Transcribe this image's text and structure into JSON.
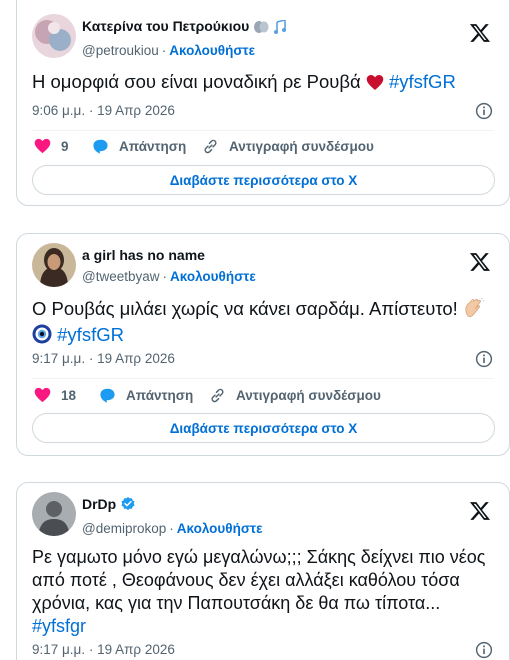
{
  "tweets": [
    {
      "author_name": "Κατερίνα του Πετρούκιου",
      "handle": "@petroukiou",
      "follow_label": "Ακολουθήστε",
      "text": "Η ομορφιά σου είναι μοναδική ρε Ρουβά",
      "hashtag": "#yfsfGR",
      "timestamp": "9:06 μ.μ. · 19 Απρ 2026",
      "likes": "9",
      "reply_label": "Απάντηση",
      "copy_link_label": "Αντιγραφή συνδέσμου",
      "read_more_label": "Διαβάστε περισσότερα στο X"
    },
    {
      "author_name": "a girl has no name",
      "handle": "@tweetbyaw",
      "follow_label": "Ακολουθήστε",
      "text": "Ο Ρουβάς μιλάει χωρίς να κάνει σαρδάμ. Απίστευτο!",
      "hashtag": "#yfsfGR",
      "timestamp": "9:17 μ.μ. · 19 Απρ 2026",
      "likes": "18",
      "reply_label": "Απάντηση",
      "copy_link_label": "Αντιγραφή συνδέσμου",
      "read_more_label": "Διαβάστε περισσότερα στο X"
    },
    {
      "author_name": "DrDp",
      "handle": "@demiprokop",
      "follow_label": "Ακολουθήστε",
      "text_line1": "Ρε γαμωτο μόνο εγώ μεγαλώνω;;; Σάκης δείχνει πιο νέος",
      "text_line2": "από ποτέ , Θεοφάνους δεν έχει αλλάξει καθόλου τόσα",
      "text_line3": "χρόνια, κας για την Παπουτσάκη δε θα πω τίποτα...",
      "hashtag": "#yfsfgr",
      "timestamp": "9:17 μ.μ. · 19 Απρ 2026"
    }
  ],
  "colors": {
    "link_blue": "#006fd6",
    "like_pink": "#f91880",
    "reply_blue": "#1d9bf0",
    "border": "#cfd9de",
    "muted_text": "#536471"
  },
  "icons": [
    "x-logo-icon",
    "info-icon",
    "heart-icon",
    "reply-bubble-icon",
    "link-icon",
    "verified-badge-icon",
    "heart-emoji-icon",
    "clapping-hands-emoji-icon",
    "nazar-eye-emoji-icon",
    "theatre-masks-emoji-icon",
    "music-notes-emoji-icon"
  ]
}
